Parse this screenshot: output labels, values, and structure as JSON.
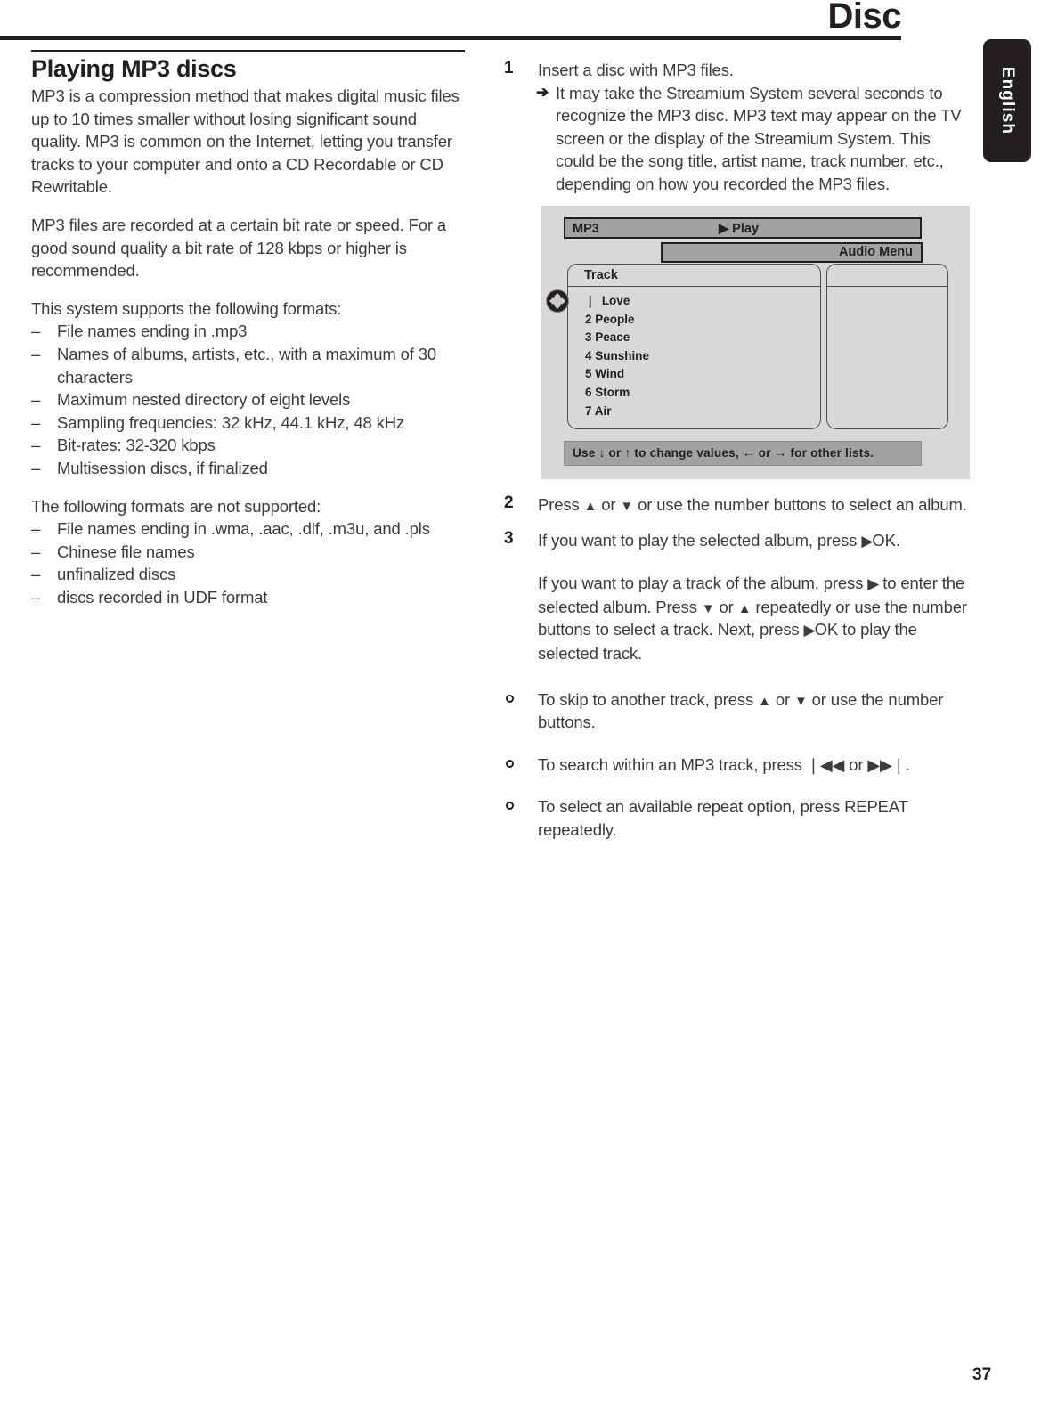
{
  "header": {
    "title": "Disc",
    "language_tab": "English"
  },
  "footer": {
    "page_number": "37"
  },
  "left_column": {
    "section_title": "Playing MP3 discs",
    "intro_paragraph": "MP3 is a compression method that makes digital music files up to 10 times smaller without losing significant sound quality. MP3 is common on the Internet, letting you transfer tracks to your computer and onto a CD Recordable or CD Rewritable.",
    "bitrate_paragraph": "MP3 files are recorded at a certain bit rate or speed. For a good sound quality a bit rate of 128 kbps or higher is recommended.",
    "supported_heading": "This system supports the following formats:",
    "supported_items": [
      "File names ending in .mp3",
      "Names of albums, artists, etc., with a maximum of 30 characters",
      "Maximum nested directory of eight levels",
      "Sampling frequencies: 32 kHz, 44.1 kHz, 48 kHz",
      "Bit-rates: 32-320 kbps",
      "Multisession discs, if finalized"
    ],
    "unsupported_heading": "The following formats are not supported:",
    "unsupported_items": [
      "File names ending in .wma, .aac, .dlf, .m3u, and .pls",
      "Chinese file names",
      "unfinalized discs",
      "discs recorded in UDF format"
    ],
    "dash_marker": "–"
  },
  "right_column": {
    "step1": {
      "number": "1",
      "text": "Insert a disc with MP3 files.",
      "arrow_marker": "➔",
      "result_text": "It may take the Streamium System several seconds to recognize the MP3 disc. MP3 text may appear on the TV screen or the display of the Streamium System. This could be the song title, artist name, track number, etc., depending on how you recorded the MP3 files."
    },
    "step2": {
      "number": "2",
      "text_a": "Press ",
      "up_glyph": "▲",
      "text_b": " or ",
      "down_glyph": "▼",
      "text_c": " or use the number buttons to select an album."
    },
    "step3": {
      "number": "3",
      "line1_a": "If you want to play the selected album, press ",
      "line1_play": "▶",
      "line1_b": "OK.",
      "para2_a": "If you want to play a track of the album, press ",
      "para2_play1": "▶",
      "para2_b": " to enter the selected album. Press ",
      "para2_down": "▼",
      "para2_c": " or ",
      "para2_up": "▲",
      "para2_d": " repeatedly or use the number buttons to select a track. Next, press ",
      "para2_play2": "▶",
      "para2_e": "OK to play the selected track."
    },
    "bullets": [
      {
        "marker": "ring",
        "text_a": "To skip to another track, press ",
        "glyph1": "▲",
        "text_b": " or ",
        "glyph2": "▼",
        "text_c": " or use the number buttons."
      },
      {
        "marker": "ring",
        "text_a": "To search within an MP3 track, press ",
        "glyph1": "❘◀◀",
        "text_b": " or ",
        "glyph2": "▶▶❘",
        "text_c": "."
      },
      {
        "marker": "ring",
        "text_a": "To select an available repeat option, press REPEAT repeatedly.",
        "glyph1": "",
        "text_b": "",
        "glyph2": "",
        "text_c": ""
      }
    ]
  },
  "screen_mock": {
    "source_label": "MP3",
    "play_label": "▶ Play",
    "audio_menu_label": "Audio Menu",
    "track_panel_header": "Track",
    "tracks": [
      "❘  Love",
      "2 People",
      "3 Peace",
      "4 Sunshine",
      "5 Wind",
      "6 Storm",
      "7 Air"
    ],
    "hint_text": "Use ↓ or ↑ to change values, ← or → for other lists.",
    "colors": {
      "panel_background": "#d8d8d8",
      "bar_fill": "#a2a2a2",
      "border": "#231f20"
    }
  }
}
